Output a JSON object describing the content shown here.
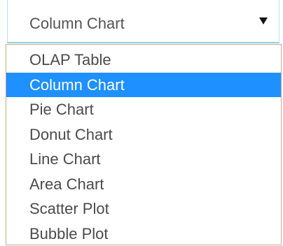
{
  "select": {
    "value": "Column Chart",
    "caret_icon": "caret-down-icon"
  },
  "options": [
    {
      "label": "OLAP Table",
      "selected": false
    },
    {
      "label": "Column Chart",
      "selected": true
    },
    {
      "label": "Pie Chart",
      "selected": false
    },
    {
      "label": "Donut Chart",
      "selected": false
    },
    {
      "label": "Line Chart",
      "selected": false
    },
    {
      "label": "Area Chart",
      "selected": false
    },
    {
      "label": "Scatter Plot",
      "selected": false
    },
    {
      "label": "Bubble Plot",
      "selected": false
    }
  ],
  "colors": {
    "highlight": "#1e90ff",
    "highlight_text": "#ffffff",
    "text": "#4b4b4b",
    "select_border": "#8fd0e2",
    "list_border": "#c8a98a"
  }
}
